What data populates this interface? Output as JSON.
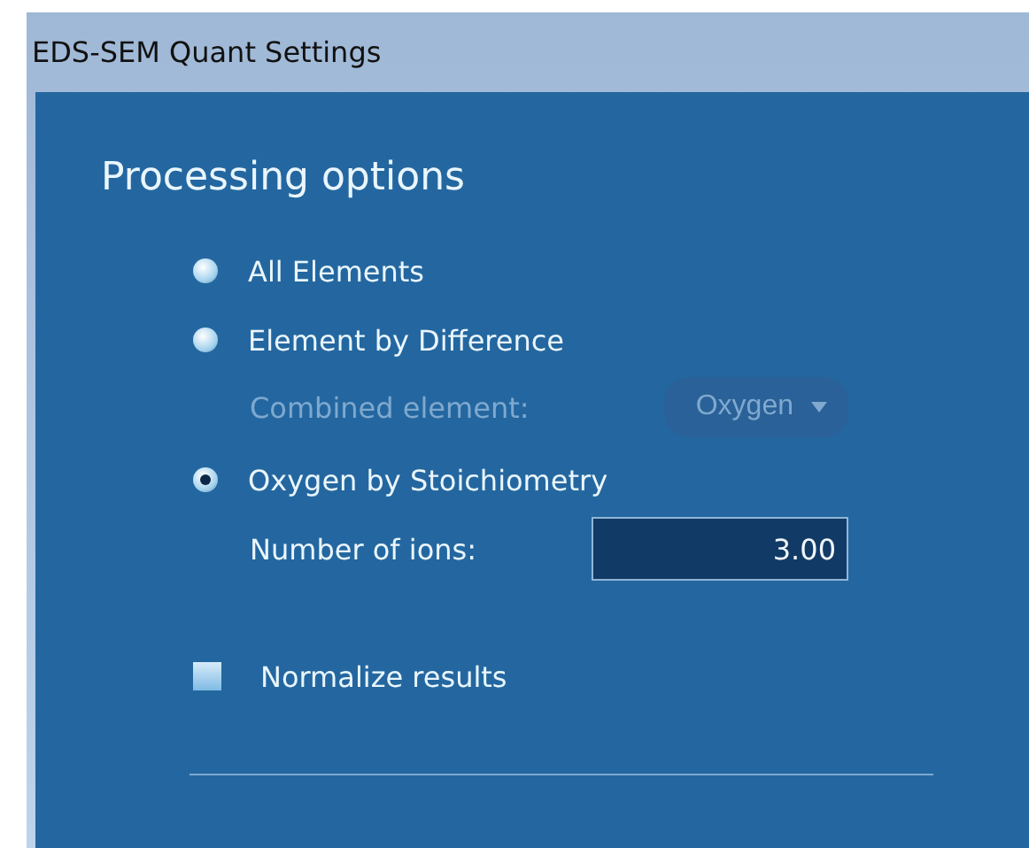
{
  "window": {
    "title": "EDS-SEM Quant Settings"
  },
  "heading": "Processing options",
  "options": [
    {
      "label": "All Elements",
      "selected": false
    },
    {
      "label": "Element by Difference",
      "selected": false,
      "sub": {
        "label": "Combined element:",
        "value": "Oxygen",
        "disabled": true
      }
    },
    {
      "label": "Oxygen by Stoichiometry",
      "selected": true,
      "sub": {
        "label": "Number of ions:",
        "value": "3.00",
        "disabled": false
      }
    }
  ],
  "normalize": {
    "label": "Normalize results",
    "checked": false
  }
}
